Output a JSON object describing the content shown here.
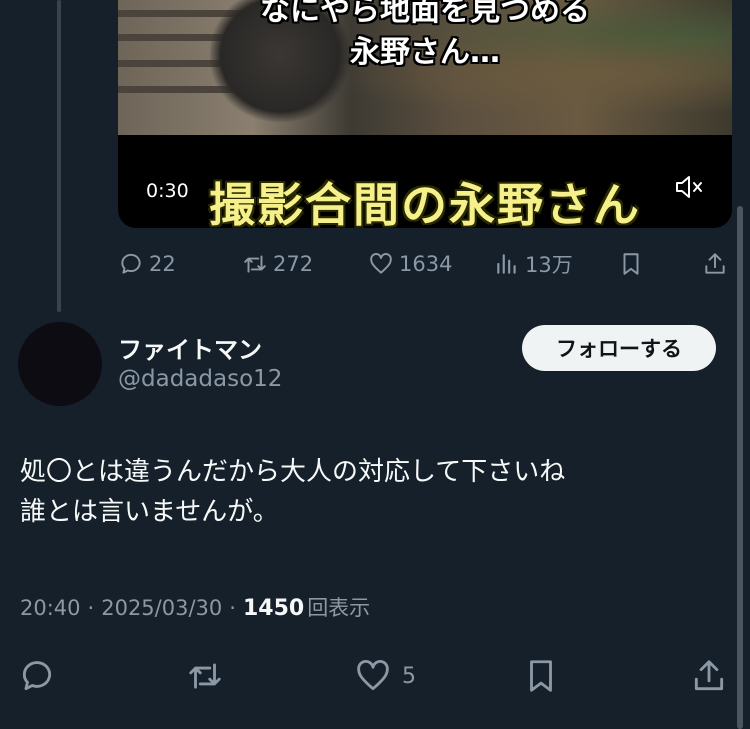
{
  "video": {
    "caption_top_lines": [
      "なにやら地面を見つめる",
      "永野さん…"
    ],
    "caption_big": "撮影合間の永野さん",
    "time": "0:30",
    "mute_icon": "mute-icon"
  },
  "quoted_actions": {
    "replies": "22",
    "reposts": "272",
    "likes": "1634",
    "views": "13万"
  },
  "author": {
    "display_name": "ファイトマン",
    "handle": "@dadadaso12",
    "follow_label": "フォローする"
  },
  "tweet": {
    "lines": [
      "処〇とは違うんだから大人の対応して下さいね",
      "誰とは言いませんが。"
    ]
  },
  "meta": {
    "time": "20:40",
    "date": "2025/03/30",
    "separator": "·",
    "views_count": "1450",
    "views_label": "回表示"
  },
  "actions": {
    "likes": "5"
  },
  "colors": {
    "background": "#15202b",
    "text_primary": "#f7f9f9",
    "text_secondary": "#8b98a5",
    "follow_bg": "#eff3f4",
    "caption_yellow": "#f6f08a"
  }
}
